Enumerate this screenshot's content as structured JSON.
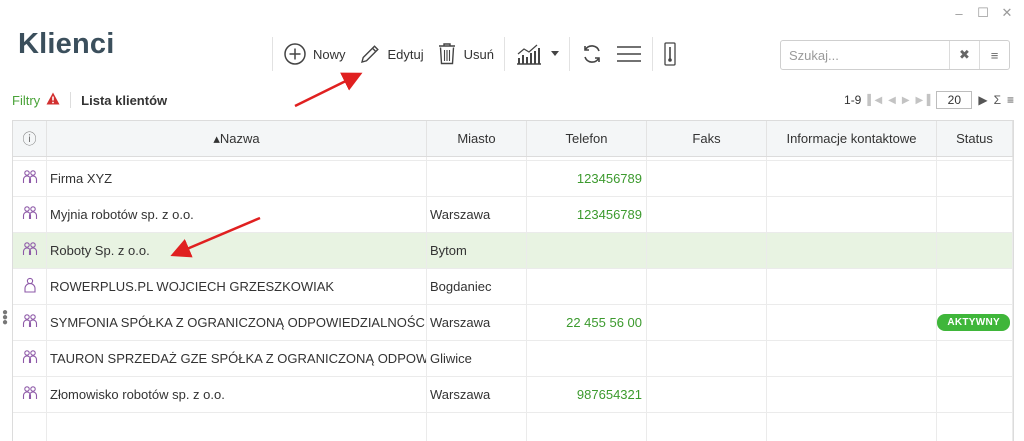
{
  "window": {
    "minimize": "–",
    "maximize": "☐",
    "close": "✕"
  },
  "title": "Klienci",
  "toolbar": {
    "new_label": "Nowy",
    "edit_label": "Edytuj",
    "delete_label": "Usuń"
  },
  "search": {
    "placeholder": "Szukaj...",
    "value": ""
  },
  "subbar": {
    "filters_label": "Filtry",
    "list_title": "Lista klientów",
    "range": "1-9",
    "page_size": "20"
  },
  "columns": {
    "info": "ⓘ",
    "name": "▴Nazwa",
    "city": "Miasto",
    "phone": "Telefon",
    "fax": "Faks",
    "contact": "Informacje kontaktowe",
    "status": "Status"
  },
  "rows": [
    {
      "type": "group",
      "name": "Firma XYZ",
      "city": "",
      "phone": "123456789",
      "fax": "",
      "contact": "",
      "status": ""
    },
    {
      "type": "group",
      "name": "Myjnia robotów sp. z o.o.",
      "city": "Warszawa",
      "phone": "123456789",
      "fax": "",
      "contact": "",
      "status": ""
    },
    {
      "type": "group",
      "name": "Roboty Sp. z o.o.",
      "city": "Bytom",
      "phone": "",
      "fax": "",
      "contact": "",
      "status": ""
    },
    {
      "type": "person",
      "name": "ROWERPLUS.PL WOJCIECH GRZESZKOWIAK",
      "city": "Bogdaniec",
      "phone": "",
      "fax": "",
      "contact": "",
      "status": ""
    },
    {
      "type": "group",
      "name": "SYMFONIA SPÓŁKA Z OGRANICZONĄ ODPOWIEDZIALNOŚCIĄ",
      "city": "Warszawa",
      "phone": "22 455 56 00",
      "fax": "",
      "contact": "",
      "status": "AKTYWNY"
    },
    {
      "type": "group",
      "name": "TAURON SPRZEDAŻ GZE SPÓŁKA Z OGRANICZONĄ ODPOWIEDZIALNOŚCIĄ",
      "city": "Gliwice",
      "phone": "",
      "fax": "",
      "contact": "",
      "status": ""
    },
    {
      "type": "group",
      "name": "Złomowisko robotów sp. z o.o.",
      "city": "Warszawa",
      "phone": "987654321",
      "fax": "",
      "contact": "",
      "status": ""
    }
  ],
  "colors": {
    "title": "#3b4f5c",
    "filters": "#4aa339",
    "phone": "#3c9a2e",
    "selected_row": "#e8f3e2",
    "badge": "#3fb63a",
    "annotation_arrow": "#e02020",
    "row_icon": "#8e5aa8"
  },
  "icons": {
    "new": "plus-circle-icon",
    "edit": "pencil-icon",
    "delete": "trash-icon",
    "chart": "bar-chart-icon",
    "refresh": "refresh-icon",
    "menu": "hamburger-icon",
    "export": "thermometer-icon",
    "filter_warning": "warning-icon",
    "clear_search": "close-icon",
    "search_menu": "menu-icon"
  }
}
